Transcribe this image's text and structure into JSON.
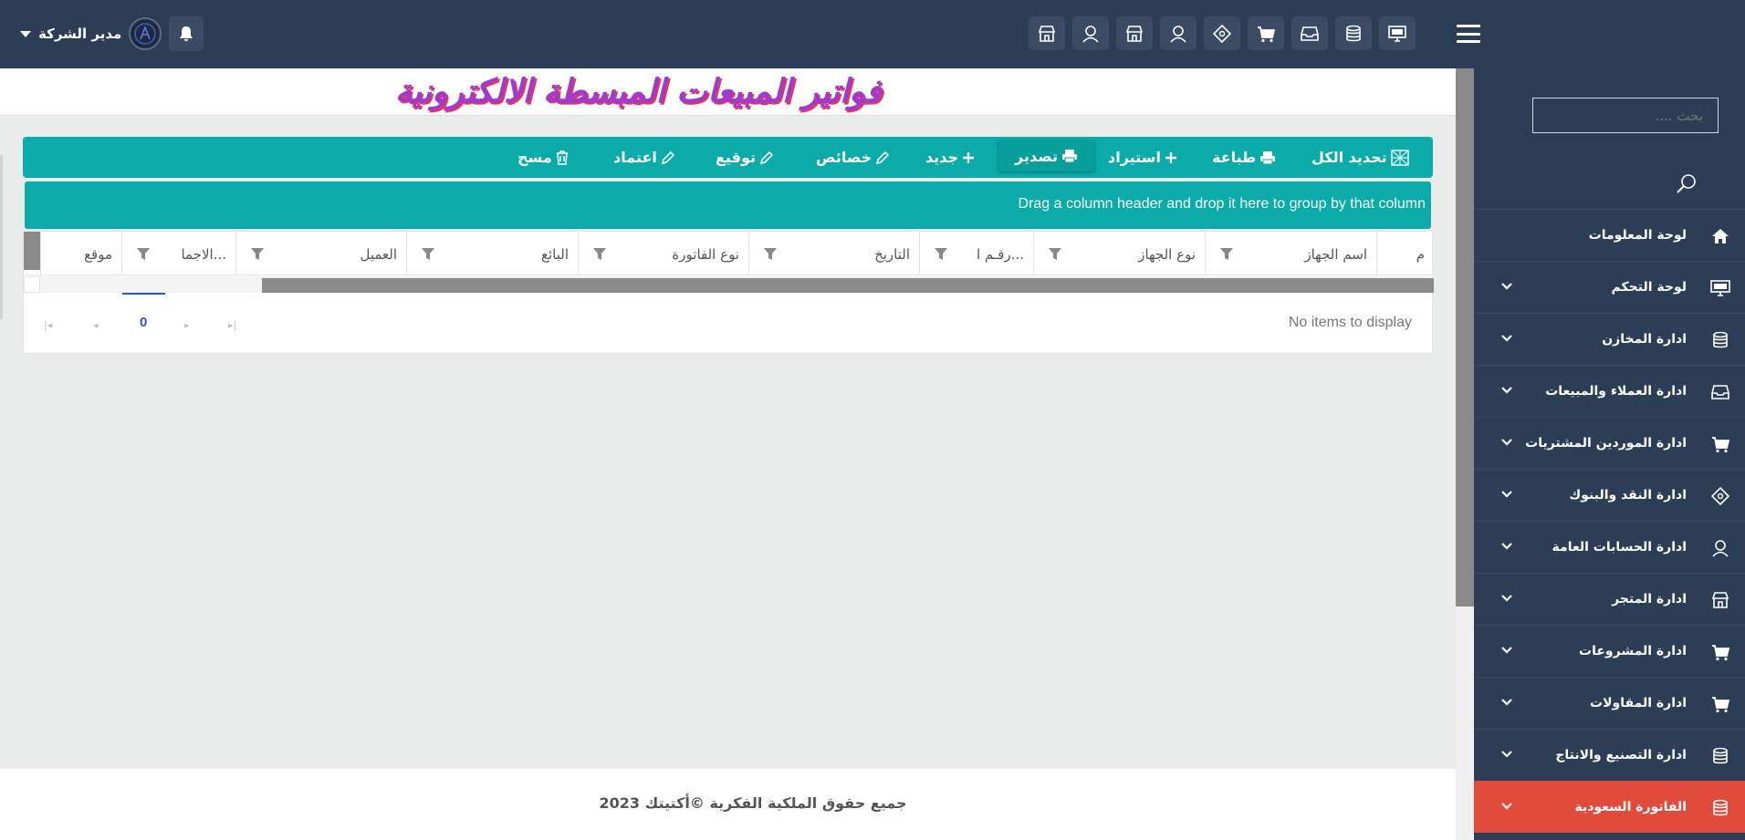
{
  "header": {
    "user_name": "مدير الشركة",
    "top_icons": [
      "monitor-icon",
      "database-icon",
      "inbox-icon",
      "cart-icon",
      "money-icon",
      "user-icon",
      "store-icon",
      "user-icon",
      "store-icon"
    ]
  },
  "page": {
    "title": "فواتير المبيعات المبسطة الالكترونية"
  },
  "toolbar": {
    "items": [
      {
        "label": "تحديد الكل",
        "icon": "select-all-icon"
      },
      {
        "label": "طباعة",
        "icon": "print-icon"
      },
      {
        "label": "استيراد",
        "icon": "plus-icon"
      },
      {
        "label": "تصدير",
        "icon": "print-icon"
      },
      {
        "label": "جديد",
        "icon": "plus-icon"
      },
      {
        "label": "خصائص",
        "icon": "pencil-icon"
      },
      {
        "label": "توقيع",
        "icon": "pencil-icon"
      },
      {
        "label": "اعتماد",
        "icon": "pencil-icon"
      },
      {
        "label": "مسح",
        "icon": "trash-icon"
      }
    ]
  },
  "grid": {
    "group_hint": "Drag a column header and drop it here to group by that column",
    "columns": [
      "م",
      "اسم الجهاز",
      "نوع الجهاز",
      "رقـم ا...",
      "التاريخ",
      "نوع الفاتورة",
      "البائع",
      "العميل",
      "الاجما...",
      "موقع"
    ],
    "empty_text": "No items to display",
    "page_number": "0"
  },
  "sidebar": {
    "search_placeholder": "بحث ....",
    "items": [
      {
        "label": "لوحة المعلومات",
        "icon": "home-icon",
        "has_children": false
      },
      {
        "label": "لوحة التحكم",
        "icon": "monitor-icon",
        "has_children": true
      },
      {
        "label": "ادارة المخازن",
        "icon": "database-icon",
        "has_children": true
      },
      {
        "label": "ادارة العملاء والمبيعات",
        "icon": "inbox-icon",
        "has_children": true
      },
      {
        "label": "ادارة الموردين المشتريات",
        "icon": "cart-icon",
        "has_children": true
      },
      {
        "label": "ادارة النقد والبنوك",
        "icon": "money-icon",
        "has_children": true
      },
      {
        "label": "ادارة الحسابات العامة",
        "icon": "user-icon",
        "has_children": true
      },
      {
        "label": "ادارة المتجر",
        "icon": "store-icon",
        "has_children": true
      },
      {
        "label": "ادارة المشروعات",
        "icon": "cart-icon",
        "has_children": true
      },
      {
        "label": "ادارة المقاولات",
        "icon": "cart-icon",
        "has_children": true
      },
      {
        "label": "ادارة التصنيع والانتاج",
        "icon": "database-icon",
        "has_children": true
      },
      {
        "label": "الفاتورة السعودية",
        "icon": "database-icon",
        "has_children": true,
        "active": true
      }
    ]
  },
  "footer": {
    "text": "جميع حقوق الملكية الفكرية ©أكتيتك 2023"
  },
  "colors": {
    "navy": "#2c3e55",
    "teal": "#0aaba9",
    "active_red": "#e04b3b",
    "title_purple": "#9b3bd4",
    "title_shadow": "#e8335a"
  }
}
